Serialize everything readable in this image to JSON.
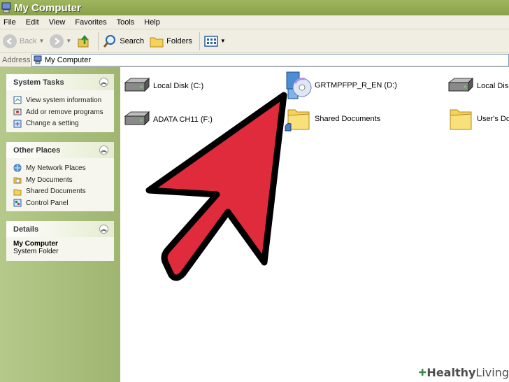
{
  "window": {
    "title": "My Computer"
  },
  "menubar": {
    "items": [
      "File",
      "Edit",
      "View",
      "Favorites",
      "Tools",
      "Help"
    ]
  },
  "toolbar": {
    "back_label": "Back",
    "search_label": "Search",
    "folders_label": "Folders"
  },
  "address": {
    "label": "Address",
    "value": "My Computer"
  },
  "system_tasks": {
    "title": "System Tasks",
    "items": [
      "View system information",
      "Add or remove programs",
      "Change a setting"
    ]
  },
  "other_places": {
    "title": "Other Places",
    "items": [
      "My Network Places",
      "My Documents",
      "Shared Documents",
      "Control Panel"
    ]
  },
  "details": {
    "title": "Details",
    "name": "My Computer",
    "type": "System Folder"
  },
  "content": {
    "items": [
      {
        "label": "Local Disk (C:)",
        "icon": "hard-drive-icon"
      },
      {
        "label": "GRTMPFPP_R_EN (D:)",
        "icon": "cd-drive-icon"
      },
      {
        "label": "Local Disk",
        "icon": "hard-drive-icon"
      },
      {
        "label": "ADATA CH11 (F:)",
        "icon": "hard-drive-icon"
      },
      {
        "label": "Shared Documents",
        "icon": "shared-folder-icon"
      },
      {
        "label": "User's Do",
        "icon": "folder-icon"
      }
    ]
  },
  "watermark": {
    "part1": "Healthy",
    "part2": "Living"
  },
  "colors": {
    "arrow": "#e02b3c",
    "titlebar": "#8aa14b",
    "leftpane": "#a7bd7a"
  }
}
